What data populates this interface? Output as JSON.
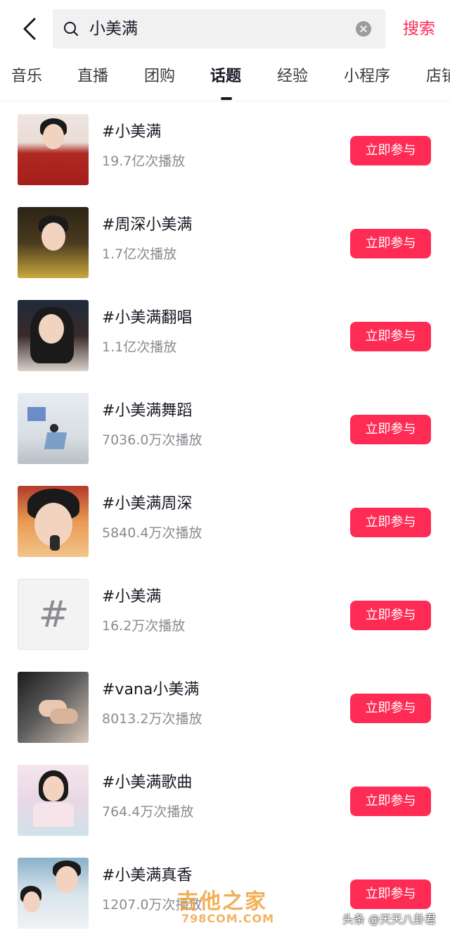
{
  "search": {
    "query": "小美满",
    "button_label": "搜索"
  },
  "tabs": [
    {
      "label": "音乐"
    },
    {
      "label": "直播"
    },
    {
      "label": "团购"
    },
    {
      "label": "话题",
      "active": true
    },
    {
      "label": "经验"
    },
    {
      "label": "小程序"
    },
    {
      "label": "店铺"
    }
  ],
  "topics": [
    {
      "title": "#小美满",
      "plays": "19.7亿次播放",
      "button": "立即参与"
    },
    {
      "title": "#周深小美满",
      "plays": "1.7亿次播放",
      "button": "立即参与"
    },
    {
      "title": "#小美满翻唱",
      "plays": "1.1亿次播放",
      "button": "立即参与"
    },
    {
      "title": "#小美满舞蹈",
      "plays": "7036.0万次播放",
      "button": "立即参与"
    },
    {
      "title": "#小美满周深",
      "plays": "5840.4万次播放",
      "button": "立即参与"
    },
    {
      "title": "#小美满",
      "plays": "16.2万次播放",
      "button": "立即参与"
    },
    {
      "title": "#vana小美满",
      "plays": "8013.2万次播放",
      "button": "立即参与"
    },
    {
      "title": "#小美满歌曲",
      "plays": "764.4万次播放",
      "button": "立即参与"
    },
    {
      "title": "#小美满真香",
      "plays": "1207.0万次播放",
      "button": "立即参与"
    }
  ],
  "placeholder_thumb_symbol": "#",
  "watermark": {
    "site_name": "吉他之家",
    "site_url": "798COM.COM",
    "author": "头条 @天天八卦君"
  },
  "colors": {
    "accent": "#fe2c55",
    "text_primary": "#161823",
    "text_secondary": "#8a8b91"
  }
}
